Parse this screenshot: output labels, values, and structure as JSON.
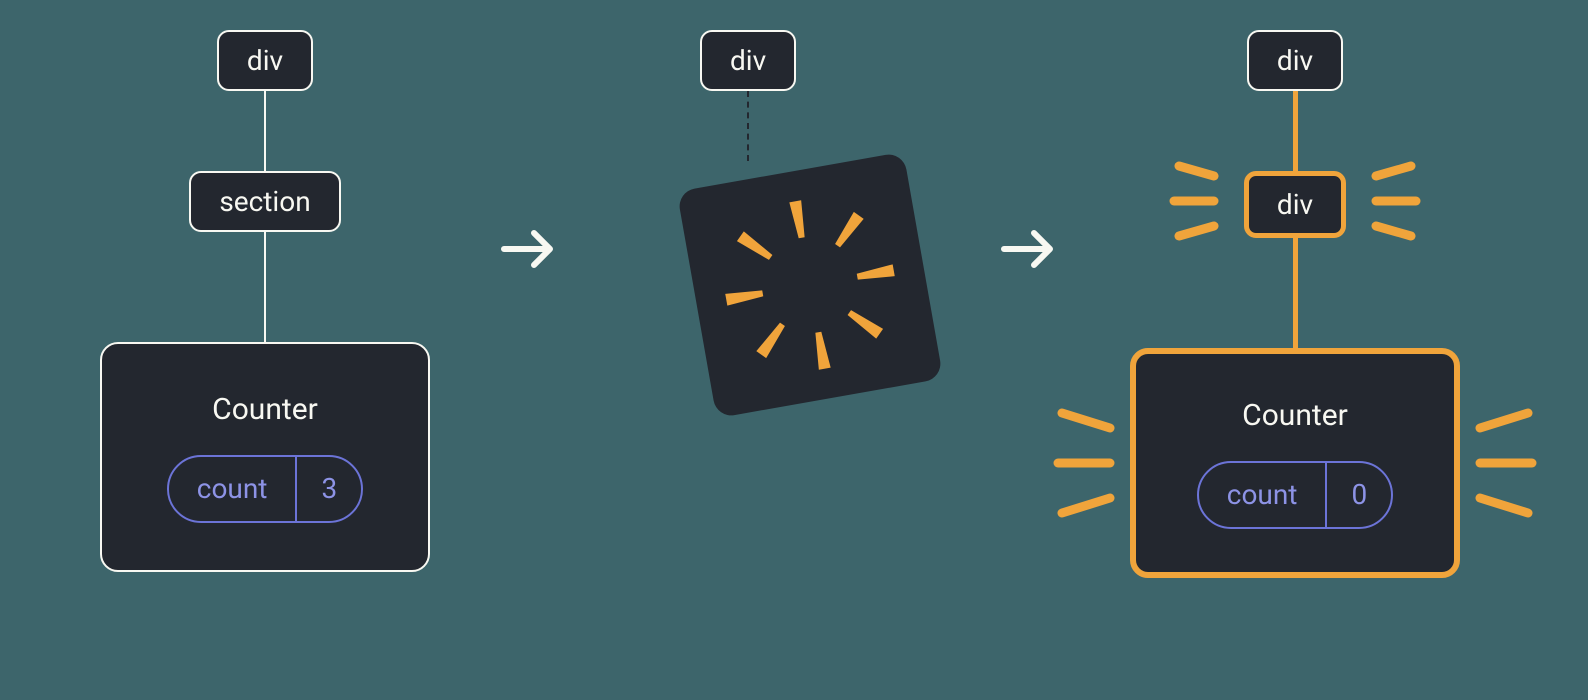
{
  "left": {
    "root": "div",
    "mid": "section",
    "component": "Counter",
    "state_label": "count",
    "state_value": "3"
  },
  "middle": {
    "root": "div"
  },
  "right": {
    "root": "div",
    "mid": "div",
    "component": "Counter",
    "state_label": "count",
    "state_value": "0"
  },
  "colors": {
    "node_bg": "#23272f",
    "node_border": "#f8f8f2",
    "highlight": "#f0a43b",
    "state": "#6c74d8",
    "state_text": "#8d93e6",
    "bg": "#3d656b"
  }
}
